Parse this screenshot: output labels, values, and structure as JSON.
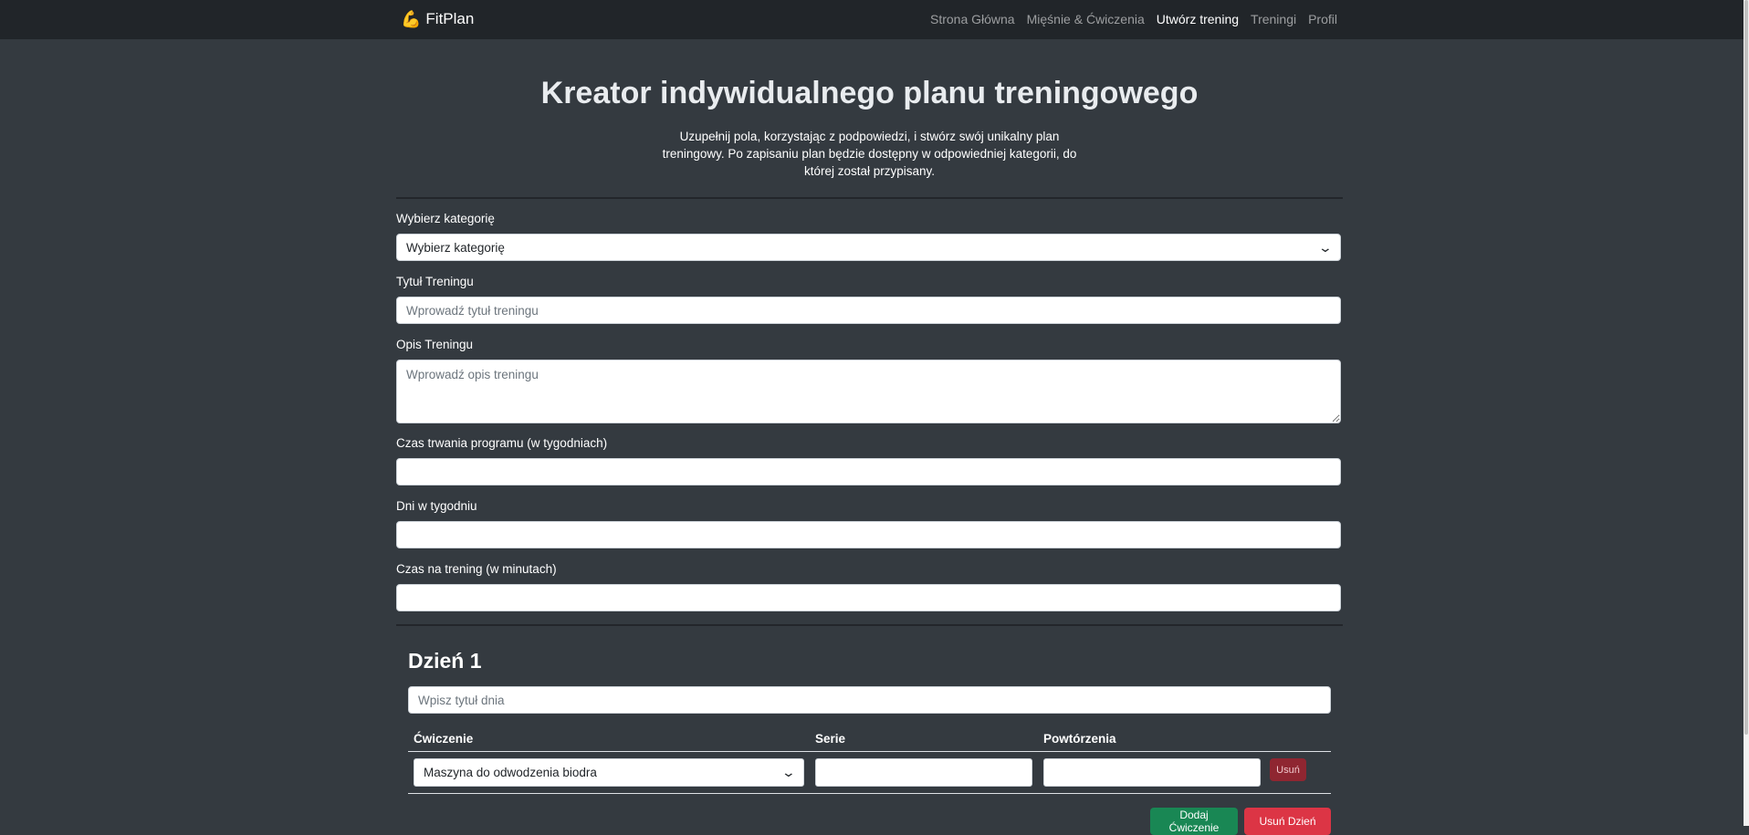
{
  "navbar": {
    "brand": "FitPlan",
    "brand_icon": "flexed-biceps-icon",
    "links": [
      "Strona Główna",
      "Mięśnie & Ćwiczenia",
      "Utwórz trening",
      "Treningi",
      "Profil"
    ],
    "active_link": "Utwórz trening"
  },
  "header": {
    "title": "Kreator indywidualnego planu treningowego",
    "subtitle": "Uzupełnij pola, korzystając z podpowiedzi, i stwórz swój unikalny plan treningowy. Po zapisaniu plan będzie dostępny w odpowiedniej kategorii, do której został przypisany."
  },
  "form": {
    "category_label": "Wybierz kategorię",
    "category_value": "Wybierz kategorię",
    "title_label": "Tytuł Treningu",
    "title_placeholder": "Wprowadź tytuł treningu",
    "description_label": "Opis Treningu",
    "description_placeholder": "Wprowadź opis treningu",
    "duration_label": "Czas trwania programu (w tygodniach)",
    "days_label": "Dni w tygodniu",
    "session_label": "Czas na trening (w minutach)"
  },
  "day": {
    "title": "Dzień 1",
    "title_placeholder": "Wpisz tytuł dnia",
    "columns": [
      "Ćwiczenie",
      "Serie",
      "Powtórzenia"
    ],
    "rows": [
      {
        "exercise": "Maszyna do odwodzenia biodra",
        "sets": "",
        "reps": ""
      }
    ],
    "remove_label": "Usuń",
    "add_exercise_label": "Dodaj Ćwiczenie",
    "remove_day_label": "Usuń Dzień"
  },
  "colors": {
    "background": "#343a40",
    "navbar": "#212529",
    "success": "#198754",
    "danger": "#dc3545"
  }
}
